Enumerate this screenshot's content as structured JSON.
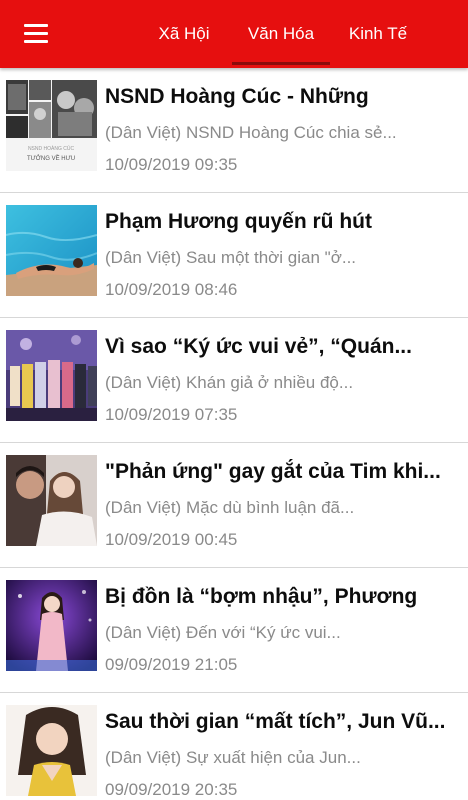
{
  "header": {
    "tabs": [
      {
        "label": "Xã Hội"
      },
      {
        "label": "Văn Hóa"
      },
      {
        "label": "Kinh Tế"
      }
    ],
    "active_tab": "Văn Hóa",
    "accent_color": "#e60f0f",
    "menu_icon": "hamburger-menu-icon"
  },
  "articles": [
    {
      "title": "NSND Hoàng Cúc - Những",
      "summary": "(Dân Việt) NSND Hoàng Cúc chia sẻ...",
      "date": "10/09/2019 09:35",
      "thumb_caption": "TƯỞNG VỀ HƯU"
    },
    {
      "title": "Phạm Hương quyến rũ hút",
      "summary": "(Dân Việt) Sau một thời gian \"ở...",
      "date": "10/09/2019 08:46"
    },
    {
      "title": "Vì sao “Ký ức vui vẻ”, “Quán...",
      "summary": "(Dân Việt) Khán giả ở nhiều độ...",
      "date": "10/09/2019 07:35"
    },
    {
      "title": "\"Phản ứng\" gay gắt của Tim khi...",
      "summary": "(Dân Việt) Mặc dù bình luận đã...",
      "date": "10/09/2019 00:45"
    },
    {
      "title": "Bị đồn là “bợm nhậu”, Phương",
      "summary": "(Dân Việt) Đến với “Ký ức vui...",
      "date": "09/09/2019 21:05"
    },
    {
      "title": "Sau thời gian “mất tích”, Jun Vũ...",
      "summary": "(Dân Việt) Sự xuất hiện của Jun...",
      "date": "09/09/2019 20:35"
    }
  ]
}
